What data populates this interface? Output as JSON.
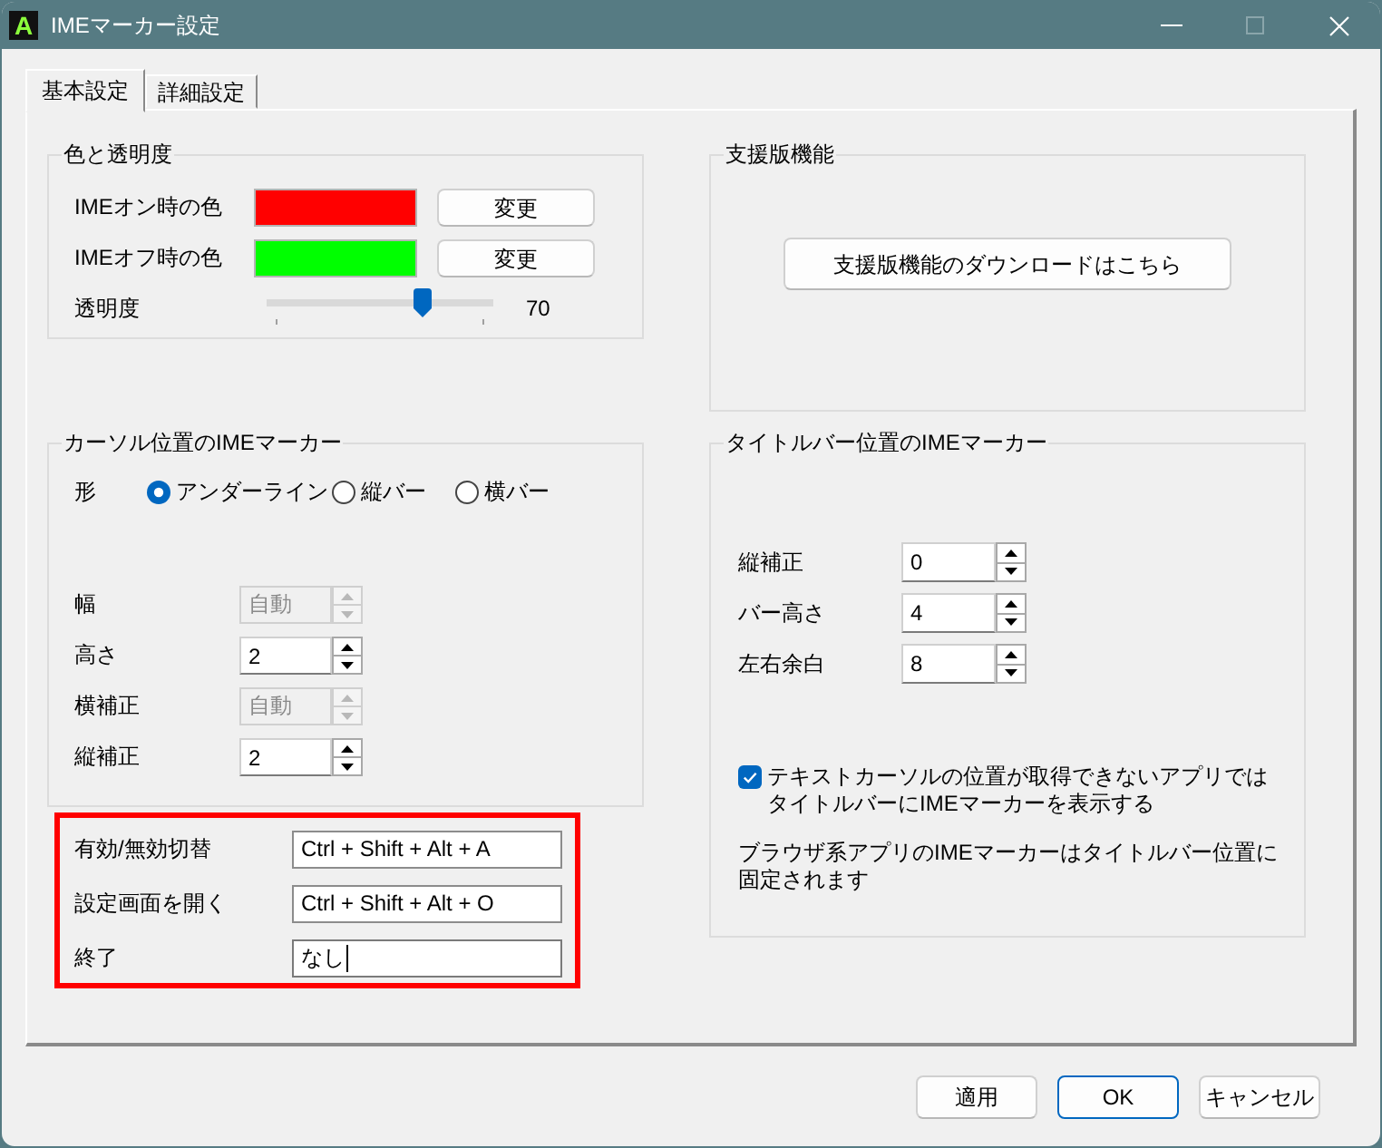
{
  "window": {
    "app_icon_text": "A",
    "title": "IMEマーカー設定"
  },
  "window_controls": [
    {
      "kind": "minimize",
      "disabled": false
    },
    {
      "kind": "maximize",
      "disabled": true
    },
    {
      "kind": "close",
      "disabled": false
    }
  ],
  "tabs": [
    {
      "label": "基本設定",
      "selected": true
    },
    {
      "label": "詳細設定",
      "selected": false
    }
  ],
  "color_group": {
    "title": "色と透明度",
    "rows": [
      {
        "label": "IMEオン時の色",
        "color": "#ff0000",
        "button": "変更"
      },
      {
        "label": "IMEオフ時の色",
        "color": "#00ff00",
        "button": "変更"
      }
    ],
    "opacity": {
      "label": "透明度",
      "level": 0.7,
      "reading": "70"
    }
  },
  "support_group": {
    "title": "支援版機能",
    "button": "支援版機能のダウンロードはこちら"
  },
  "cursor_group": {
    "title": "カーソル位置のIMEマーカー",
    "shape_label": "形",
    "shapes": [
      {
        "label": "アンダーライン",
        "selected": true
      },
      {
        "label": "縦バー",
        "selected": false
      },
      {
        "label": "横バー",
        "selected": false
      }
    ],
    "fields": [
      {
        "label": "幅",
        "value": "自動",
        "disabled": true
      },
      {
        "label": "高さ",
        "value": "2",
        "disabled": false
      },
      {
        "label": "横補正",
        "value": "自動",
        "disabled": true
      },
      {
        "label": "縦補正",
        "value": "2",
        "disabled": false
      }
    ]
  },
  "titlebar_group": {
    "title": "タイトルバー位置のIMEマーカー",
    "fields": [
      {
        "label": "縦補正",
        "value": "0"
      },
      {
        "label": "バー高さ",
        "value": "4"
      },
      {
        "label": "左右余白",
        "value": "8"
      }
    ],
    "checkbox": {
      "label": "テキストカーソルの位置が取得できないアプリではタイトルバーにIMEマーカーを表示する",
      "checked": true
    },
    "note": "ブラウザ系アプリのIMEマーカーはタイトルバー位置に固定されます"
  },
  "shortcuts": {
    "highlighted": true,
    "rows": [
      {
        "label": "有効/無効切替",
        "value": "Ctrl + Shift + Alt + A",
        "focused": false
      },
      {
        "label": "設定画面を開く",
        "value": "Ctrl + Shift + Alt + O",
        "focused": false
      },
      {
        "label": "終了",
        "value": "なし",
        "focused": true
      }
    ]
  },
  "buttons": [
    {
      "label": "適用",
      "default": false
    },
    {
      "label": "OK",
      "default": true
    },
    {
      "label": "キャンセル",
      "default": false
    }
  ]
}
